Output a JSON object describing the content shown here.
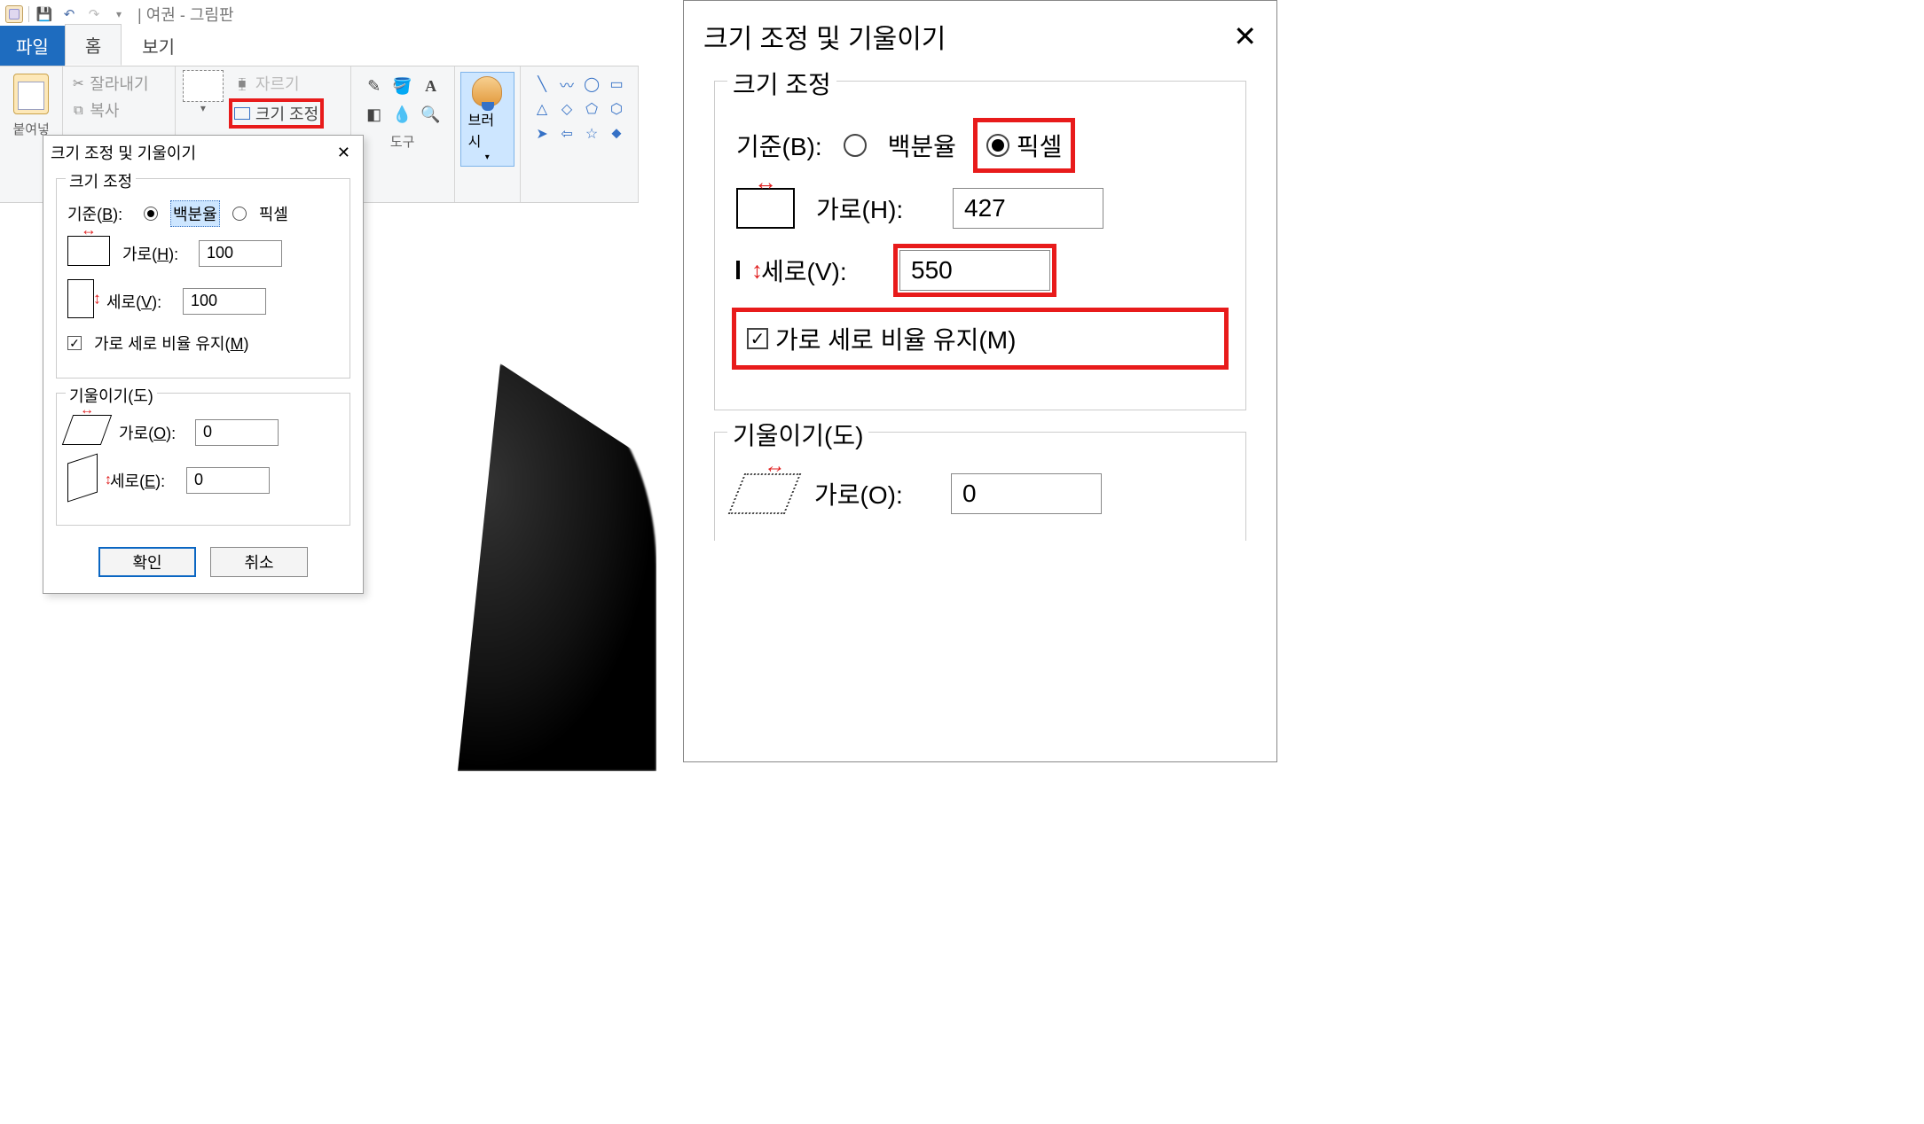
{
  "app": {
    "title_prefix": "|",
    "doc_name": "여권",
    "app_name": "그림판"
  },
  "tabs": {
    "file": "파일",
    "home": "홈",
    "view": "보기"
  },
  "ribbon": {
    "paste_label": "붙여넣",
    "cut": "잘라내기",
    "copy": "복사",
    "select_drop": "▾",
    "crop": "자르기",
    "resize": "크기 조정",
    "tools_label": "도구",
    "brush": "브러시"
  },
  "small_dialog": {
    "title": "크기 조정 및 기울이기",
    "resize_legend": "크기 조정",
    "basis_label": "기준(B):",
    "percent": "백분율",
    "pixel": "픽셀",
    "hlabel": "가로(H):",
    "vlabel": "세로(V):",
    "hval": "100",
    "vval": "100",
    "aspect": "가로 세로 비율 유지(M)",
    "skew_legend": "기울이기(도)",
    "shlabel": "가로(O):",
    "svlabel": "세로(E):",
    "shval": "0",
    "svval": "0",
    "ok": "확인",
    "cancel": "취소"
  },
  "right_dialog": {
    "title": "크기 조정 및 기울이기",
    "resize_legend": "크기 조정",
    "basis_label": "기준(B):",
    "percent": "백분율",
    "pixel": "픽셀",
    "hlabel": "가로(H):",
    "vlabel": "세로(V):",
    "hval": "427",
    "vval": "550",
    "aspect": "가로 세로 비율 유지(M)",
    "skew_legend": "기울이기(도)",
    "shlabel": "가로(O):",
    "shval": "0"
  }
}
